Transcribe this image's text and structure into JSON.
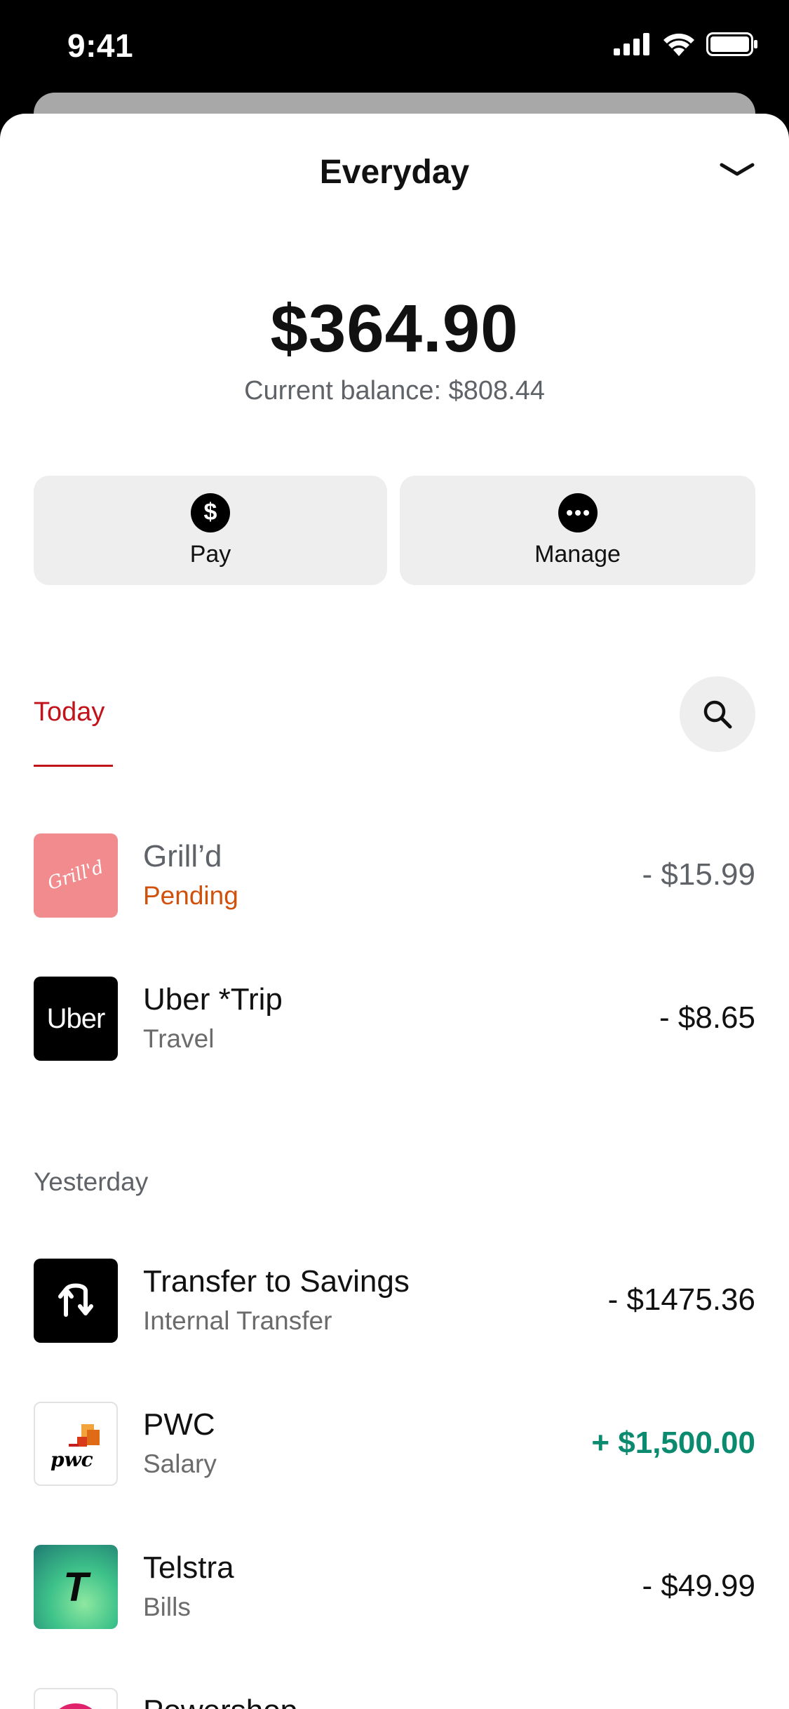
{
  "status_bar": {
    "time": "9:41"
  },
  "header": {
    "title": "Everyday"
  },
  "balance": {
    "available": "$364.90",
    "current": "Current balance: $808.44"
  },
  "actions": {
    "pay_label": "Pay",
    "manage_label": "Manage"
  },
  "tabs": {
    "today": "Today"
  },
  "sections": {
    "today": {
      "transactions": [
        {
          "name": "Grill’d",
          "subtitle": "Pending",
          "amount": "- $15.99",
          "logo_text": "Grill'd",
          "logo_color": "#f28b8e"
        },
        {
          "name": "Uber *Trip",
          "subtitle": "Travel",
          "amount": "- $8.65",
          "logo_text": "Uber",
          "logo_color": "#000000"
        }
      ]
    },
    "yesterday": {
      "label": "Yesterday",
      "transactions": [
        {
          "name": "Transfer to Savings",
          "subtitle": "Internal Transfer",
          "amount": "- $1475.36",
          "icon": "transfer-icon"
        },
        {
          "name": "PWC",
          "subtitle": "Salary",
          "amount": "+ $1,500.00",
          "logo_text": "pwc"
        },
        {
          "name": "Telstra",
          "subtitle": "Bills",
          "amount": "- $49.99",
          "logo_text": "T"
        },
        {
          "name": "Powershop"
        }
      ]
    }
  },
  "colors": {
    "accent": "#c2121b",
    "pending": "#d0510c",
    "positive": "#0a8a6f"
  }
}
